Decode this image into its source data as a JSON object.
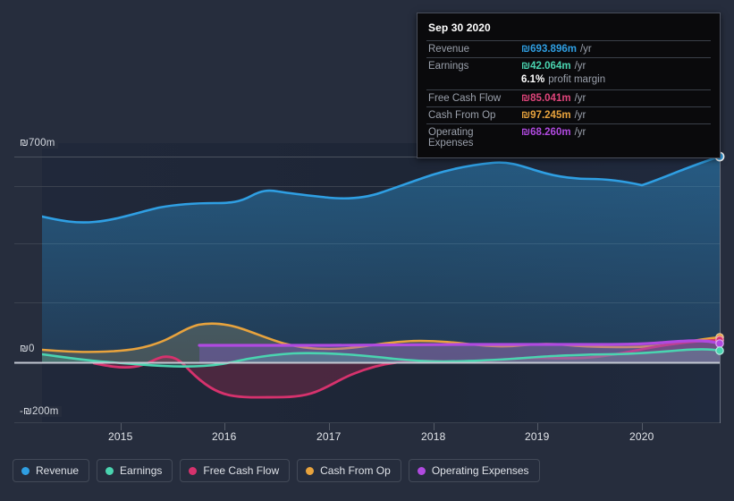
{
  "tooltip": {
    "date": "Sep 30 2020",
    "rows": [
      {
        "label": "Revenue",
        "value": "₪693.896m",
        "unit": "/yr",
        "color": "#2f9fe3"
      },
      {
        "label": "Earnings",
        "value": "₪42.064m",
        "unit": "/yr",
        "color": "#4ad4b0"
      },
      {
        "label": "Free Cash Flow",
        "value": "₪85.041m",
        "unit": "/yr",
        "color": "#e0457b"
      },
      {
        "label": "Cash From Op",
        "value": "₪97.245m",
        "unit": "/yr",
        "color": "#e8a33d"
      },
      {
        "label": "Operating Expenses",
        "value": "₪68.260m",
        "unit": "/yr",
        "color": "#b04ae0"
      }
    ],
    "profit_margin_value": "6.1%",
    "profit_margin_label": "profit margin"
  },
  "legend": {
    "items": [
      {
        "label": "Revenue",
        "color": "#2f9fe3"
      },
      {
        "label": "Earnings",
        "color": "#4ad4b0"
      },
      {
        "label": "Free Cash Flow",
        "color": "#d6326d"
      },
      {
        "label": "Cash From Op",
        "color": "#e8a33d"
      },
      {
        "label": "Operating Expenses",
        "color": "#b04ae0"
      }
    ]
  },
  "axes": {
    "y_labels": [
      "₪700m",
      "₪0",
      "-₪200m"
    ],
    "x_labels": [
      "2015",
      "2016",
      "2017",
      "2018",
      "2019",
      "2020"
    ]
  },
  "chart_data": {
    "type": "area",
    "title": "",
    "xlabel": "",
    "ylabel": "",
    "currency": "₪",
    "unit": "m",
    "ylim": [
      -250,
      760
    ],
    "yticks": [
      700,
      0,
      -200
    ],
    "grid": true,
    "legend_position": "bottom",
    "x": [
      "2014-09",
      "2014-12",
      "2015-03",
      "2015-06",
      "2015-09",
      "2015-12",
      "2016-03",
      "2016-06",
      "2016-09",
      "2016-12",
      "2017-03",
      "2017-06",
      "2017-09",
      "2017-12",
      "2018-03",
      "2018-06",
      "2018-09",
      "2018-12",
      "2019-03",
      "2019-06",
      "2019-09",
      "2019-12",
      "2020-03",
      "2020-06",
      "2020-09"
    ],
    "x_tick_labels": [
      "2015",
      "2016",
      "2017",
      "2018",
      "2019",
      "2020"
    ],
    "series": [
      {
        "name": "Revenue",
        "color": "#2f9fe3",
        "values": [
          466,
          452,
          448,
          456,
          478,
          498,
          505,
          506,
          508,
          520,
          535,
          528,
          520,
          528,
          548,
          568,
          590,
          604,
          612,
          628,
          622,
          612,
          600,
          640,
          694
        ]
      },
      {
        "name": "Earnings",
        "color": "#4ad4b0",
        "values": [
          26,
          18,
          10,
          2,
          -6,
          -10,
          -12,
          -10,
          -4,
          2,
          6,
          8,
          10,
          8,
          4,
          0,
          -2,
          0,
          4,
          8,
          12,
          14,
          16,
          28,
          42
        ]
      },
      {
        "name": "Free Cash Flow",
        "color": "#d6326d",
        "values": [
          null,
          null,
          -4,
          -14,
          -8,
          -2,
          -12,
          -48,
          -80,
          -92,
          -98,
          -96,
          -92,
          -70,
          -32,
          -12,
          -6,
          -2,
          2,
          0,
          -4,
          2,
          10,
          46,
          85
        ]
      },
      {
        "name": "Cash From Op",
        "color": "#e8a33d",
        "values": [
          30,
          26,
          22,
          20,
          20,
          24,
          40,
          66,
          86,
          94,
          92,
          80,
          62,
          44,
          32,
          28,
          30,
          34,
          44,
          52,
          46,
          38,
          40,
          58,
          97
        ]
      },
      {
        "name": "Operating Expenses",
        "color": "#b04ae0",
        "values": [
          null,
          null,
          null,
          null,
          null,
          null,
          null,
          44,
          44,
          44,
          44,
          44,
          44,
          44,
          46,
          46,
          46,
          46,
          46,
          48,
          46,
          46,
          48,
          58,
          68
        ]
      }
    ]
  }
}
